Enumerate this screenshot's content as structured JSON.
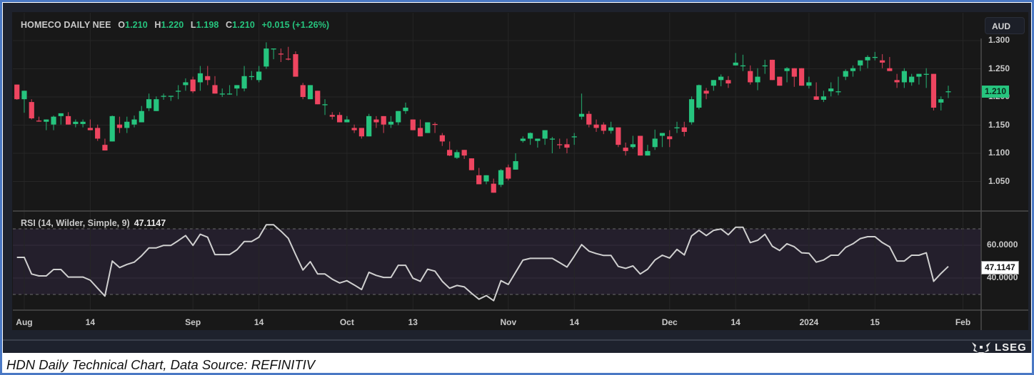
{
  "header": {
    "symbol_label": "HOMECO DAILY NEE",
    "open_label": "O",
    "open": "1.210",
    "high_label": "H",
    "high": "1.220",
    "low_label": "L",
    "low": "1.198",
    "close_label": "C",
    "close": "1.210",
    "change": "+0.015 (+1.26%)"
  },
  "currency_button": "AUD",
  "caption": "HDN Daily Technical Chart, Data Source: REFINITIV",
  "logo_text": "LSEG",
  "colors": {
    "up": "#26c47e",
    "down": "#ee4560",
    "rsi_line": "#d0d0d0",
    "rsi_band": "#241f2c"
  },
  "chart_data": [
    {
      "type": "candlestick",
      "title": "HOMECO DAILY NEE",
      "ylabel": "AUD",
      "ylim": [
        1.0,
        1.31
      ],
      "y_ticks": [
        "1.300",
        "1.250",
        "1.200",
        "1.150",
        "1.100",
        "1.050"
      ],
      "y_tick_values": [
        1.3,
        1.25,
        1.2,
        1.15,
        1.1,
        1.05
      ],
      "last_price_label": "1.210",
      "last_price": 1.21,
      "candles_ohlc": [
        [
          1.222,
          1.222,
          1.195,
          1.196
        ],
        [
          1.196,
          1.211,
          1.172,
          1.211
        ],
        [
          1.191,
          1.196,
          1.16,
          1.162
        ],
        [
          1.158,
          1.165,
          1.156,
          1.157
        ],
        [
          1.156,
          1.16,
          1.141,
          1.16
        ],
        [
          1.151,
          1.167,
          1.141,
          1.165
        ],
        [
          1.166,
          1.171,
          1.151,
          1.171
        ],
        [
          1.166,
          1.173,
          1.151,
          1.151
        ],
        [
          1.152,
          1.16,
          1.146,
          1.156
        ],
        [
          1.152,
          1.16,
          1.146,
          1.156
        ],
        [
          1.145,
          1.16,
          1.141,
          1.141
        ],
        [
          1.145,
          1.151,
          1.122,
          1.126
        ],
        [
          1.115,
          1.126,
          1.105,
          1.105
        ],
        [
          1.121,
          1.167,
          1.121,
          1.166
        ],
        [
          1.151,
          1.165,
          1.136,
          1.145
        ],
        [
          1.145,
          1.165,
          1.136,
          1.156
        ],
        [
          1.151,
          1.167,
          1.146,
          1.16
        ],
        [
          1.155,
          1.184,
          1.155,
          1.175
        ],
        [
          1.18,
          1.206,
          1.175,
          1.196
        ],
        [
          1.175,
          1.201,
          1.175,
          1.196
        ],
        [
          1.201,
          1.206,
          1.195,
          1.202
        ],
        [
          1.201,
          1.202,
          1.193,
          1.202
        ],
        [
          1.21,
          1.221,
          1.196,
          1.211
        ],
        [
          1.221,
          1.233,
          1.211,
          1.226
        ],
        [
          1.231,
          1.236,
          1.207,
          1.21
        ],
        [
          1.226,
          1.255,
          1.211,
          1.242
        ],
        [
          1.237,
          1.255,
          1.221,
          1.23
        ],
        [
          1.221,
          1.237,
          1.206,
          1.206
        ],
        [
          1.205,
          1.215,
          1.2,
          1.206
        ],
        [
          1.205,
          1.221,
          1.204,
          1.206
        ],
        [
          1.215,
          1.221,
          1.202,
          1.221
        ],
        [
          1.215,
          1.255,
          1.21,
          1.237
        ],
        [
          1.236,
          1.246,
          1.23,
          1.237
        ],
        [
          1.23,
          1.255,
          1.226,
          1.245
        ],
        [
          1.254,
          1.297,
          1.25,
          1.286
        ],
        [
          1.285,
          1.286,
          1.267,
          1.286
        ],
        [
          1.277,
          1.286,
          1.262,
          1.276
        ],
        [
          1.268,
          1.289,
          1.265,
          1.267
        ],
        [
          1.276,
          1.281,
          1.236,
          1.236
        ],
        [
          1.221,
          1.225,
          1.196,
          1.2
        ],
        [
          1.196,
          1.221,
          1.196,
          1.221
        ],
        [
          1.211,
          1.211,
          1.187,
          1.187
        ],
        [
          1.186,
          1.196,
          1.168,
          1.187
        ],
        [
          1.168,
          1.173,
          1.16,
          1.165
        ],
        [
          1.168,
          1.173,
          1.155,
          1.155
        ],
        [
          1.155,
          1.166,
          1.155,
          1.16
        ],
        [
          1.145,
          1.151,
          1.136,
          1.141
        ],
        [
          1.145,
          1.145,
          1.126,
          1.13
        ],
        [
          1.13,
          1.17,
          1.13,
          1.166
        ],
        [
          1.16,
          1.166,
          1.145,
          1.155
        ],
        [
          1.166,
          1.166,
          1.136,
          1.151
        ],
        [
          1.151,
          1.166,
          1.145,
          1.156
        ],
        [
          1.155,
          1.175,
          1.15,
          1.175
        ],
        [
          1.175,
          1.19,
          1.17,
          1.181
        ],
        [
          1.16,
          1.16,
          1.141,
          1.141
        ],
        [
          1.145,
          1.16,
          1.13,
          1.13
        ],
        [
          1.136,
          1.155,
          1.136,
          1.155
        ],
        [
          1.152,
          1.155,
          1.136,
          1.151
        ],
        [
          1.132,
          1.136,
          1.113,
          1.121
        ],
        [
          1.106,
          1.121,
          1.095,
          1.096
        ],
        [
          1.092,
          1.106,
          1.09,
          1.102
        ],
        [
          1.106,
          1.106,
          1.09,
          1.096
        ],
        [
          1.091,
          1.091,
          1.07,
          1.07
        ],
        [
          1.061,
          1.074,
          1.045,
          1.045
        ],
        [
          1.05,
          1.061,
          1.045,
          1.061
        ],
        [
          1.046,
          1.055,
          1.03,
          1.03
        ],
        [
          1.044,
          1.072,
          1.04,
          1.07
        ],
        [
          1.075,
          1.08,
          1.052,
          1.055
        ],
        [
          1.071,
          1.1,
          1.071,
          1.086
        ],
        [
          1.122,
          1.13,
          1.119,
          1.126
        ],
        [
          1.126,
          1.137,
          1.115,
          1.136
        ],
        [
          1.122,
          1.126,
          1.11,
          1.126
        ],
        [
          1.126,
          1.141,
          1.115,
          1.141
        ],
        [
          1.125,
          1.129,
          1.1,
          1.126
        ],
        [
          1.116,
          1.126,
          1.108,
          1.115
        ],
        [
          1.116,
          1.126,
          1.1,
          1.11
        ],
        [
          1.129,
          1.136,
          1.115,
          1.13
        ],
        [
          1.165,
          1.206,
          1.16,
          1.17
        ],
        [
          1.17,
          1.175,
          1.146,
          1.151
        ],
        [
          1.151,
          1.16,
          1.138,
          1.145
        ],
        [
          1.151,
          1.155,
          1.134,
          1.14
        ],
        [
          1.14,
          1.156,
          1.135,
          1.146
        ],
        [
          1.146,
          1.146,
          1.111,
          1.115
        ],
        [
          1.11,
          1.119,
          1.096,
          1.104
        ],
        [
          1.111,
          1.131,
          1.108,
          1.116
        ],
        [
          1.131,
          1.131,
          1.096,
          1.096
        ],
        [
          1.096,
          1.115,
          1.096,
          1.104
        ],
        [
          1.111,
          1.142,
          1.106,
          1.126
        ],
        [
          1.131,
          1.136,
          1.111,
          1.136
        ],
        [
          1.13,
          1.141,
          1.111,
          1.125
        ],
        [
          1.145,
          1.156,
          1.136,
          1.146
        ],
        [
          1.146,
          1.156,
          1.13,
          1.138
        ],
        [
          1.155,
          1.201,
          1.151,
          1.196
        ],
        [
          1.181,
          1.222,
          1.178,
          1.221
        ],
        [
          1.211,
          1.216,
          1.196,
          1.206
        ],
        [
          1.22,
          1.23,
          1.211,
          1.23
        ],
        [
          1.23,
          1.24,
          1.219,
          1.236
        ],
        [
          1.23,
          1.237,
          1.216,
          1.224
        ],
        [
          1.256,
          1.278,
          1.256,
          1.261
        ],
        [
          1.255,
          1.275,
          1.246,
          1.256
        ],
        [
          1.246,
          1.256,
          1.222,
          1.226
        ],
        [
          1.226,
          1.251,
          1.212,
          1.236
        ],
        [
          1.255,
          1.266,
          1.241,
          1.256
        ],
        [
          1.266,
          1.266,
          1.23,
          1.23
        ],
        [
          1.236,
          1.236,
          1.22,
          1.22
        ],
        [
          1.246,
          1.253,
          1.226,
          1.251
        ],
        [
          1.251,
          1.251,
          1.218,
          1.236
        ],
        [
          1.251,
          1.251,
          1.22,
          1.22
        ],
        [
          1.22,
          1.236,
          1.215,
          1.226
        ],
        [
          1.201,
          1.226,
          1.195,
          1.195
        ],
        [
          1.195,
          1.211,
          1.191,
          1.201
        ],
        [
          1.21,
          1.226,
          1.201,
          1.215
        ],
        [
          1.209,
          1.236,
          1.203,
          1.21
        ],
        [
          1.236,
          1.249,
          1.23,
          1.246
        ],
        [
          1.246,
          1.256,
          1.236,
          1.251
        ],
        [
          1.256,
          1.265,
          1.246,
          1.265
        ],
        [
          1.265,
          1.274,
          1.251,
          1.271
        ],
        [
          1.27,
          1.28,
          1.265,
          1.271
        ],
        [
          1.265,
          1.276,
          1.251,
          1.261
        ],
        [
          1.251,
          1.271,
          1.246,
          1.246
        ],
        [
          1.23,
          1.241,
          1.216,
          1.226
        ],
        [
          1.226,
          1.251,
          1.216,
          1.246
        ],
        [
          1.226,
          1.241,
          1.22,
          1.236
        ],
        [
          1.236,
          1.241,
          1.222,
          1.241
        ],
        [
          1.24,
          1.251,
          1.216,
          1.241
        ],
        [
          1.241,
          1.241,
          1.176,
          1.181
        ],
        [
          1.19,
          1.201,
          1.176,
          1.196
        ],
        [
          1.209,
          1.22,
          1.198,
          1.21
        ]
      ]
    },
    {
      "type": "line",
      "title": "RSI (14, Wilder, Simple, 9)",
      "title_label": "RSI (14, Wilder, Simple, 9)",
      "last_value_label": "47.1147",
      "ylim": [
        20,
        80
      ],
      "bands": [
        30,
        70
      ],
      "y_ticks": [
        "60.0000",
        "40.0000"
      ],
      "y_tick_values": [
        60,
        40
      ],
      "values": [
        52.6,
        52.6,
        42.5,
        41.3,
        41.3,
        45.2,
        45.2,
        40.6,
        40.6,
        40.6,
        38.7,
        33.8,
        29.0,
        50.4,
        46.4,
        48.3,
        49.7,
        53.6,
        58.4,
        58.4,
        59.9,
        59.9,
        62.8,
        65.9,
        59.9,
        66.7,
        64.9,
        54.3,
        54.3,
        54.3,
        57.2,
        62.3,
        62.3,
        64.9,
        72.5,
        72.5,
        68.6,
        64.2,
        54.3,
        44.9,
        50.0,
        42.5,
        42.5,
        39.3,
        37.0,
        38.4,
        35.8,
        33.0,
        43.5,
        41.6,
        40.4,
        40.4,
        47.8,
        47.8,
        39.9,
        38.0,
        45.4,
        44.2,
        38.0,
        33.8,
        35.5,
        34.6,
        30.7,
        27.1,
        29.3,
        26.2,
        38.4,
        36.1,
        43.5,
        50.9,
        52.0,
        52.0,
        52.0,
        52.0,
        49.4,
        46.7,
        53.3,
        60.4,
        56.4,
        54.9,
        53.8,
        53.8,
        47.1,
        45.9,
        47.4,
        42.5,
        45.4,
        51.0,
        53.9,
        52.2,
        57.5,
        54.1,
        65.7,
        69.1,
        65.9,
        69.1,
        69.9,
        66.4,
        71.0,
        71.0,
        61.6,
        63.0,
        66.7,
        59.4,
        56.8,
        60.9,
        59.1,
        55.4,
        55.1,
        49.7,
        51.0,
        53.9,
        53.9,
        58.7,
        60.9,
        64.1,
        65.2,
        65.2,
        61.6,
        59.1,
        50.4,
        50.4,
        53.9,
        53.9,
        55.4,
        38.0,
        42.8,
        47.1
      ]
    },
    {
      "type": "time_axis",
      "labels": [
        "Aug",
        "14",
        "Sep",
        "14",
        "Oct",
        "13",
        "Nov",
        "14",
        "Dec",
        "14",
        "2024",
        "15",
        "Feb"
      ],
      "label_bar_index": [
        1,
        10,
        24,
        33,
        45,
        54,
        67,
        76,
        89,
        98,
        108,
        117,
        129
      ]
    }
  ]
}
